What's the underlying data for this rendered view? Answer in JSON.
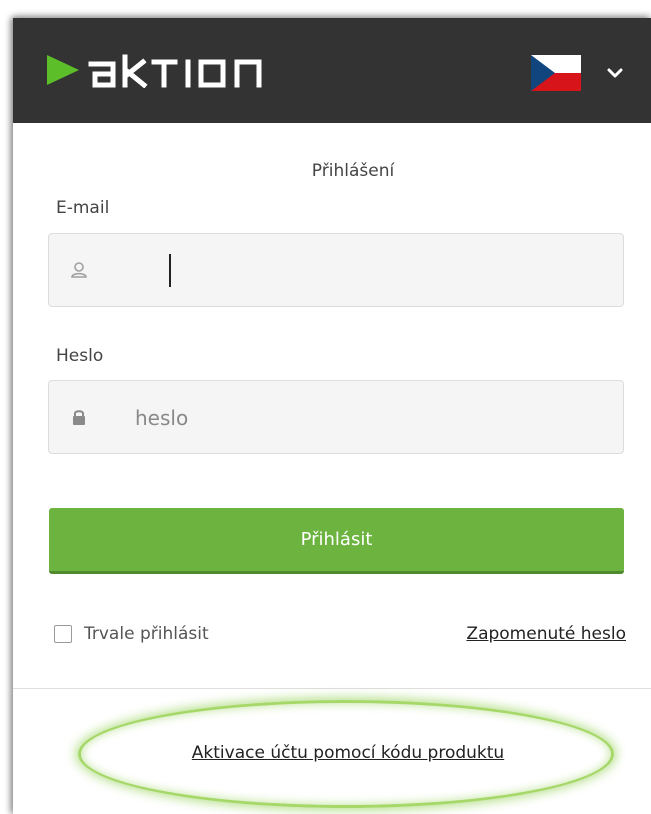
{
  "header": {
    "brand": "AKTION",
    "language": "CZ"
  },
  "form": {
    "title": "Přihlášení",
    "email_label": "E-mail",
    "email_value": "",
    "password_label": "Heslo",
    "password_placeholder": "heslo",
    "login_button": "Přihlásit",
    "remember_label": "Trvale přihlásit",
    "remember_checked": false,
    "forgot_link": "Zapomenuté heslo"
  },
  "footer": {
    "activation_link": "Aktivace účtu pomocí kódu produktu"
  },
  "colors": {
    "header_bg": "#333333",
    "accent_green": "#6cb33f",
    "highlight_green": "#a6d869"
  },
  "icons": {
    "logo": "aktion-logo",
    "flag": "czech-flag-icon",
    "dropdown": "chevron-down-icon",
    "user": "user-icon",
    "lock": "lock-icon"
  }
}
